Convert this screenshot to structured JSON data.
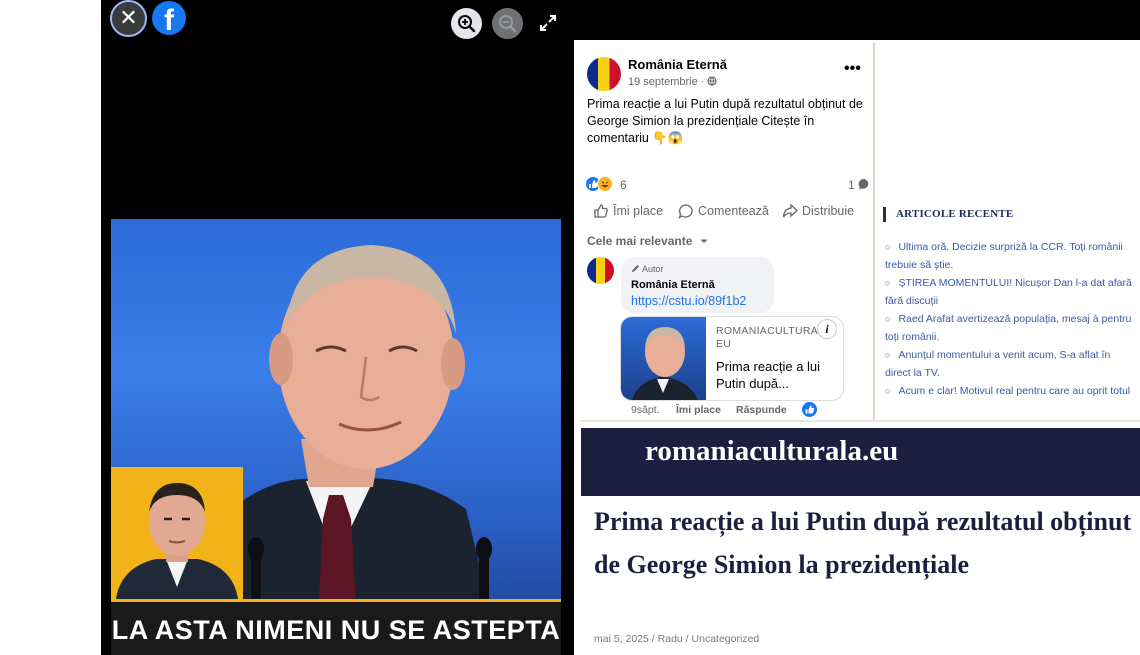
{
  "viewer": {
    "close_symbol": "✕",
    "facebook_logo": "f",
    "icons": [
      "close-icon",
      "facebook-logo-icon",
      "zoom-in-icon",
      "zoom-out-icon",
      "expand-icon"
    ],
    "photo_caption": "LA ASTA NIMENI NU SE ASTEPTA",
    "caption_accent": "#f2b21a"
  },
  "post": {
    "page_name": "România Eternă",
    "date": "19 septembrie · ",
    "more_symbol": "•••",
    "text": "Prima reacție a lui Putin după rezultatul obținut de George Simion la prezidențiale Citește în comentariu 👇😱",
    "reaction_count": "6",
    "comment_count": "1",
    "actions": {
      "like": "Îmi place",
      "comment": "Comentează",
      "share": "Distribuie"
    },
    "sort_label": "Cele mai relevante",
    "comment": {
      "author_tag": "Autor",
      "author_name": "România Eternă",
      "link": "https://cstu.io/89f1b2",
      "card_domain": "ROMANIACULTURALA.EU",
      "card_title": "Prima reacție a lui Putin după...",
      "info_symbol": "i",
      "age": "9săpt.",
      "like": "Îmi place",
      "reply": "Răspunde"
    },
    "colors": {
      "link": "#1b74e4",
      "like_blue": "#1877f2"
    }
  },
  "recent": {
    "title": "ARTICOLE RECENTE",
    "bullet": "○",
    "items": [
      "Ultima oră. Decizie surpriză la CCR. Toți românii trebuie să știe.",
      "ȘTIREA MOMENTULUI! Nicușor Dan l-a dat afară fără discuții",
      "Raed Arafat avertizează populația, mesaj à pentru toți românii.",
      "Anunțul momentului a venit acum, S-a aflat în direct la TV.",
      "Acum e clar! Motivul real pentru care au oprit totul"
    ]
  },
  "article": {
    "site_name": "romaniaculturala.eu",
    "title": "Prima reacție a lui Putin după rezultatul obținut de George Simion la prezidențiale",
    "date": "mai 5, 2025",
    "sep": " / ",
    "author": "Radu",
    "category": "Uncategorized",
    "colors": {
      "header_bg": "#1c1f3f",
      "title": "#1c1f3f"
    }
  }
}
